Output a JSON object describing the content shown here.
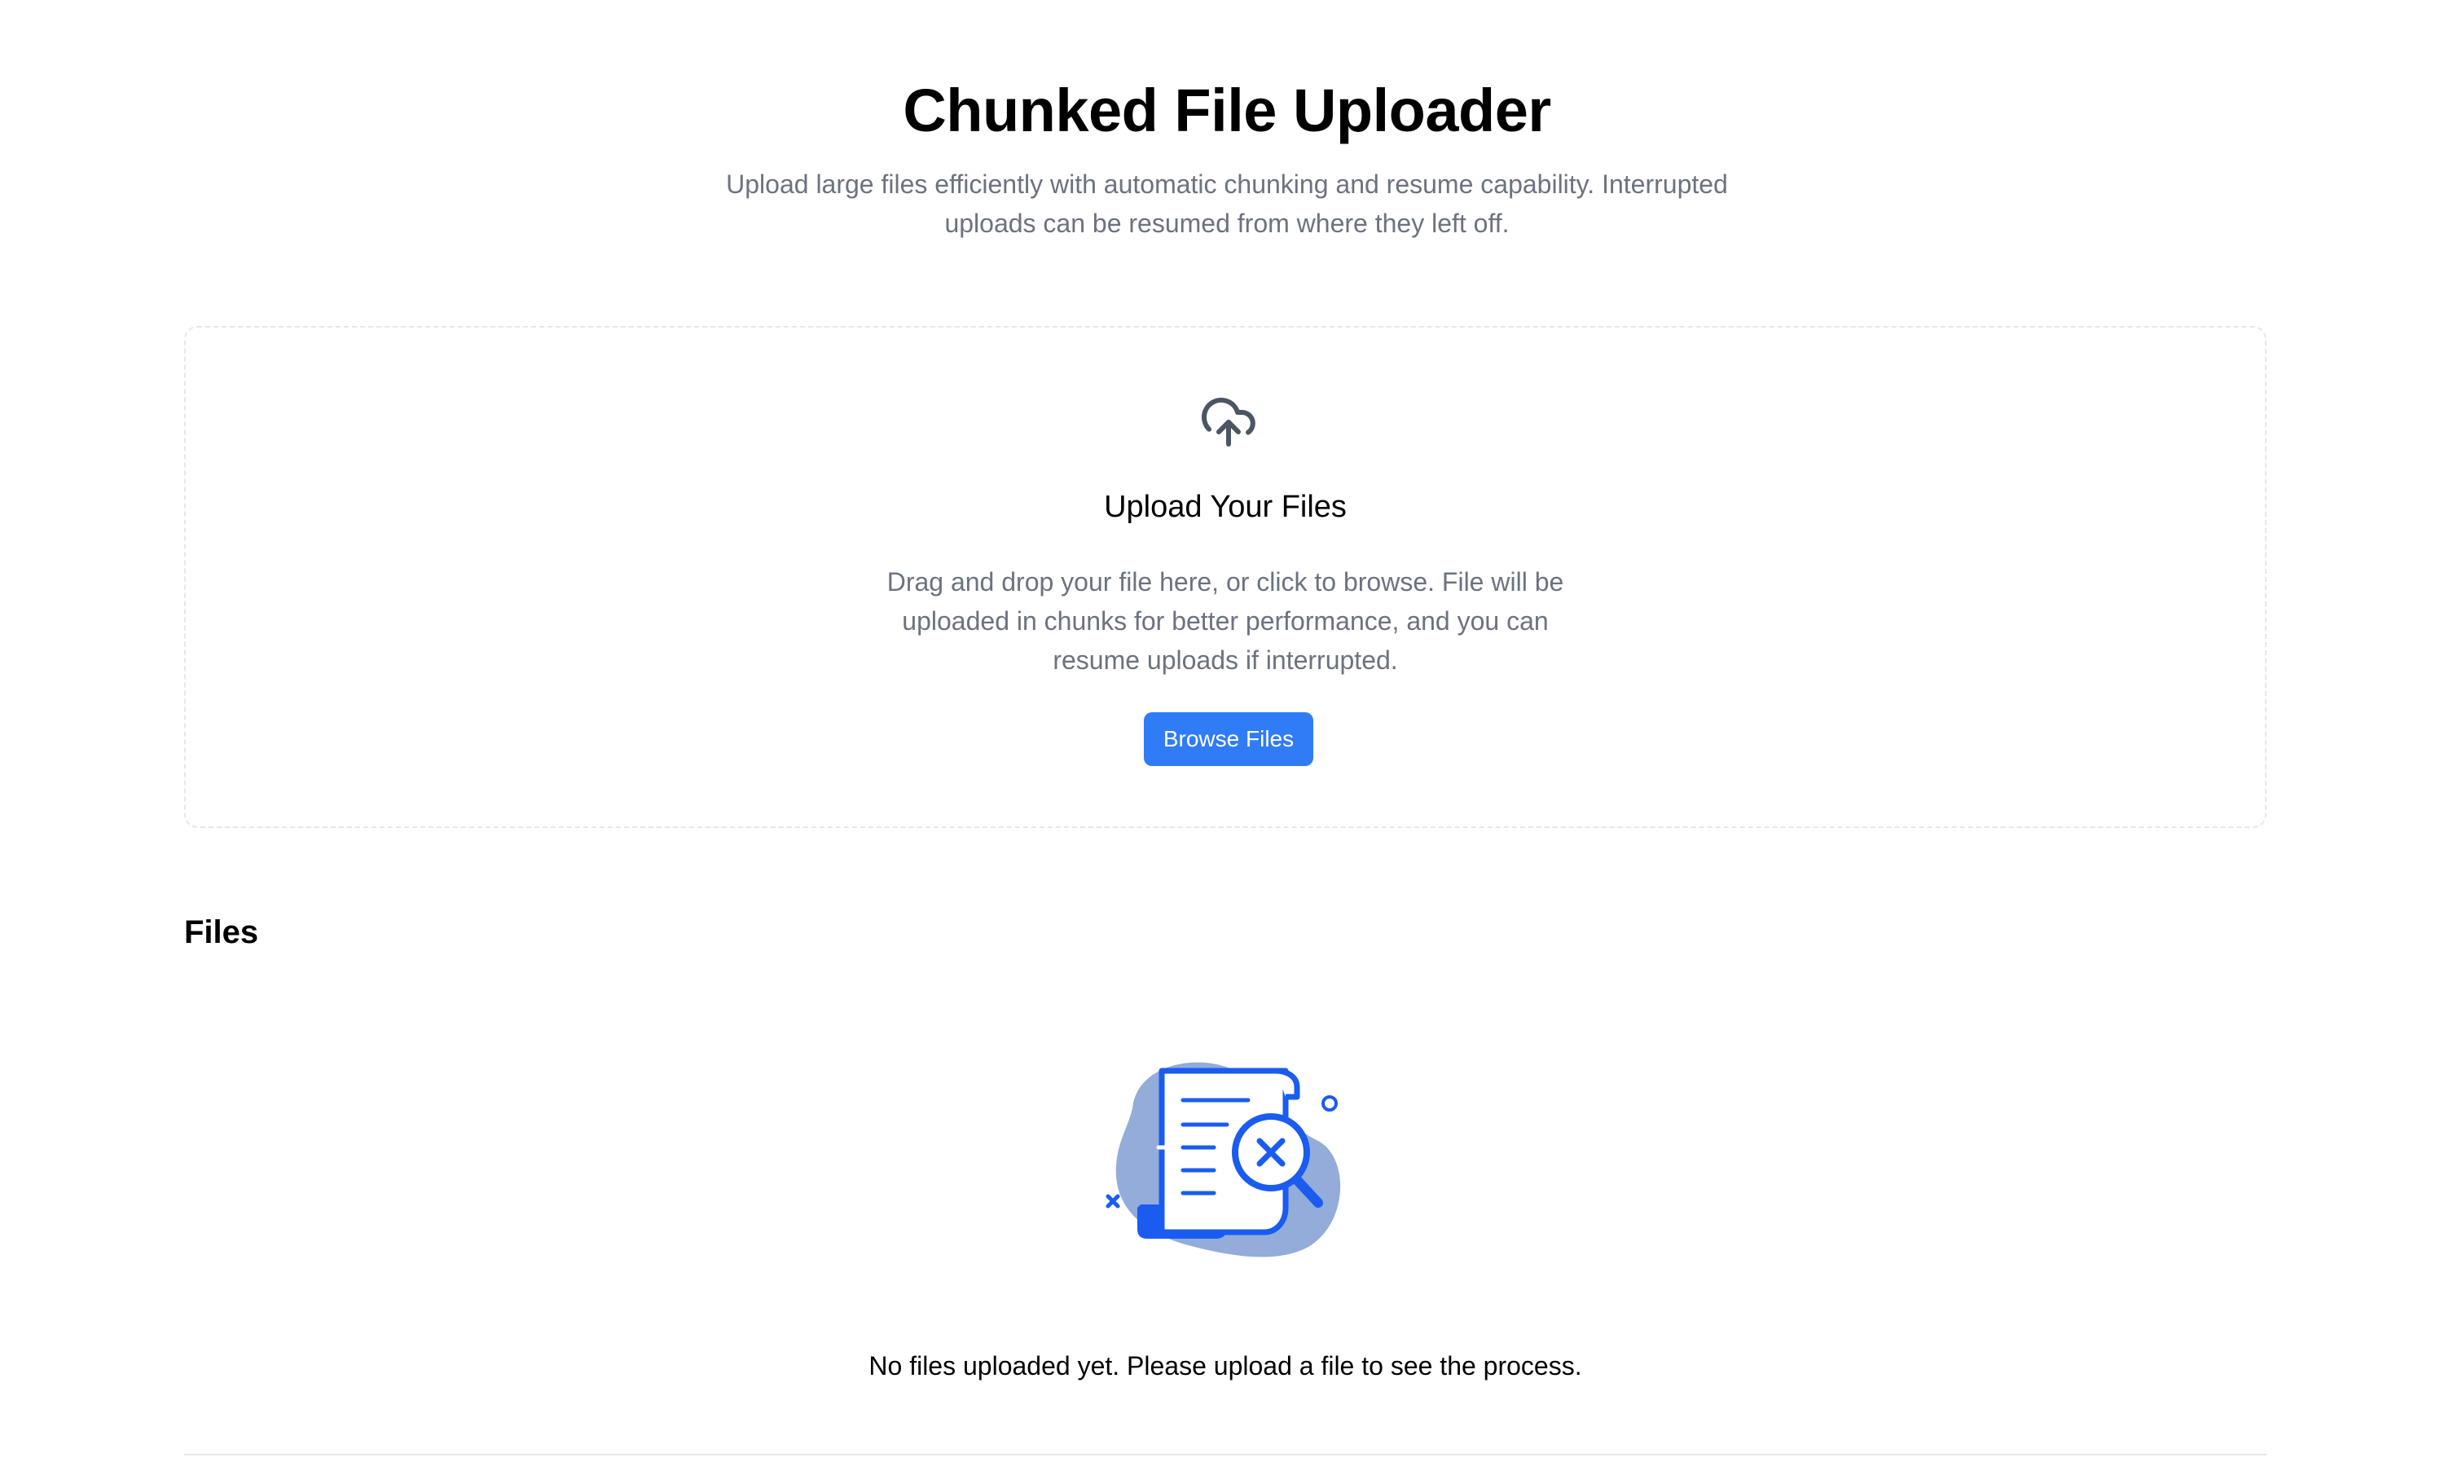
{
  "header": {
    "title": "Chunked File Uploader",
    "subtitle": "Upload large files efficiently with automatic chunking and resume capability. Interrupted uploads can be resumed from where they left off."
  },
  "dropzone": {
    "icon": "cloud-upload-icon",
    "heading": "Upload Your Files",
    "description": "Drag and drop your file here, or click to browse. File will be uploaded in chunks for better performance, and you can resume uploads if interrupted.",
    "browse_label": "Browse Files"
  },
  "files": {
    "heading": "Files",
    "empty_illustration": "empty-document-search-icon",
    "empty_message": "No files uploaded yet. Please upload a file to see the process."
  },
  "colors": {
    "accent": "#2f7cf6",
    "muted_text": "#6b7280",
    "border": "#e5e7eb",
    "illustration_blue": "#1a5cf0",
    "illustration_blob": "#93acd9"
  }
}
